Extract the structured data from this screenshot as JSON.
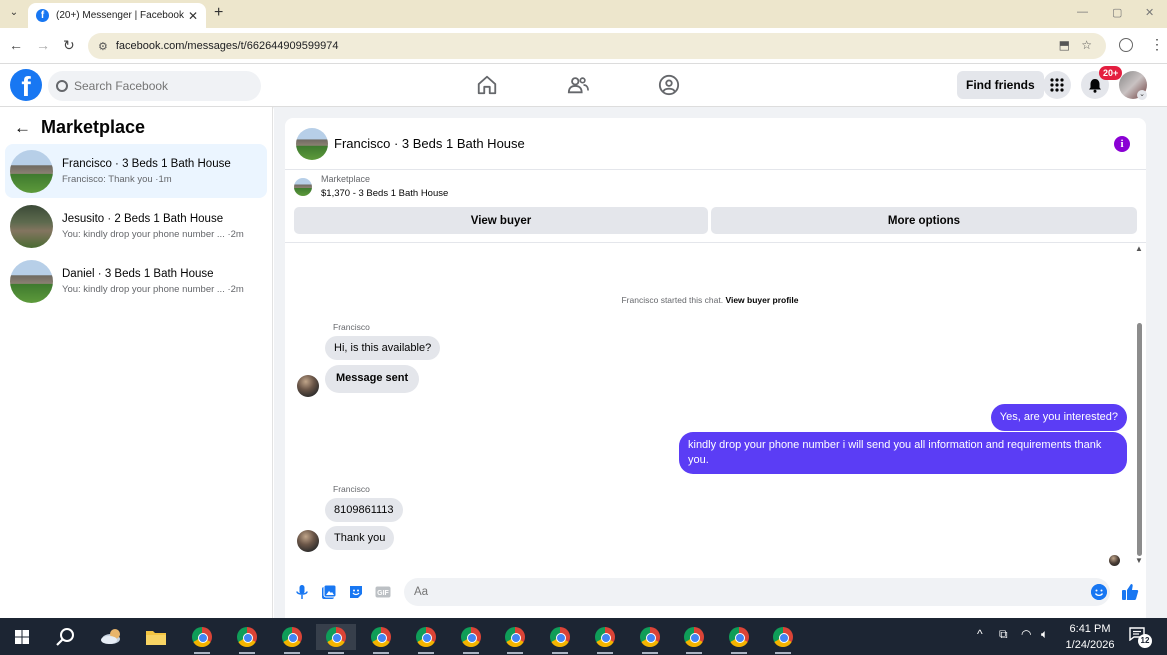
{
  "browser": {
    "tab_title": "(20+) Messenger | Facebook",
    "url": "facebook.com/messages/t/662644909599974"
  },
  "header": {
    "search_placeholder": "Search Facebook",
    "find_friends_label": "Find friends",
    "notification_badge": "20+"
  },
  "sidebar": {
    "title": "Marketplace",
    "conversations": [
      {
        "name": "Francisco · 3 Beds 1 Bath House",
        "snippet": "Francisco: Thank you ·1m",
        "active": true
      },
      {
        "name": "Jesusito · 2 Beds 1 Bath House",
        "snippet": "You: kindly drop your phone number ... ·2m",
        "active": false
      },
      {
        "name": "Daniel · 3 Beds 1 Bath House",
        "snippet": "You: kindly drop your phone number ... ·2m",
        "active": false
      }
    ]
  },
  "chat": {
    "title": "Francisco · 3 Beds 1 Bath House",
    "listing_kind": "Marketplace",
    "listing_price": "$1,370 - 3 Beds 1 Bath House",
    "view_buyer_label": "View buyer",
    "more_options_label": "More options",
    "system_text": "Francisco started this chat.",
    "system_link": "View buyer profile",
    "messages": {
      "sender1": "Francisco",
      "m1": "Hi, is this available?",
      "m2": "Message sent",
      "m3": "Yes, are you interested?",
      "m4": "kindly drop your phone number i will send you all information and requirements thank you.",
      "sender2": "Francisco",
      "m5": "8109861113",
      "m6": "Thank  you"
    },
    "input_placeholder": "Aa"
  },
  "taskbar": {
    "time": "6:41 PM",
    "date": "1/24/2026",
    "notification_count": "12"
  },
  "colors": {
    "fb_blue": "#1877f2",
    "outgoing_bubble": "#5b3df5",
    "active_conversation": "#ebf5ff",
    "notification_red": "#e41e3f",
    "taskbar": "#1c2533"
  }
}
